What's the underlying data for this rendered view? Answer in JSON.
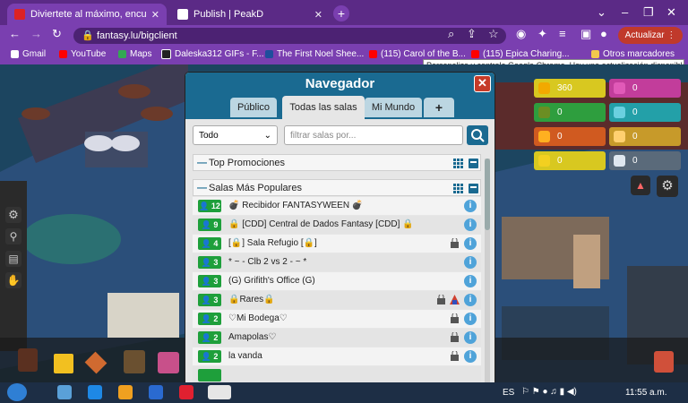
{
  "browser": {
    "tabs": [
      {
        "title": "Diviertete al máximo, encuent",
        "active": true
      },
      {
        "title": "Publish | PeakD",
        "active": false
      }
    ],
    "url": "fantasy.lu/bigclient",
    "update_label": "Actualizar",
    "bookmarks": [
      {
        "label": "Gmail",
        "color": "#ffffff"
      },
      {
        "label": "YouTube",
        "color": "#ff0000"
      },
      {
        "label": "Maps",
        "color": "#34a853"
      },
      {
        "label": "Daleska312 GIFs - F...",
        "color": "#222222"
      },
      {
        "label": "The First Noel Shee...",
        "color": "#1f4e9c"
      },
      {
        "label": "(115) Carol of the B...",
        "color": "#ff0000"
      },
      {
        "label": "(115) Epica Charing...",
        "color": "#ff0000"
      },
      {
        "label": "Otros marcadores",
        "color": "#f2c94c"
      }
    ],
    "tooltip": "Personaliza y controla Google Chrome. Hay una actualización disponible."
  },
  "navigator": {
    "title": "Navegador",
    "tabs": [
      {
        "label": "Público",
        "selected": false
      },
      {
        "label": "Todas las salas",
        "selected": true
      },
      {
        "label": "Mi Mundo",
        "selected": false
      },
      {
        "label": "+",
        "selected": false
      }
    ],
    "filter": {
      "selected": "Todo",
      "placeholder": "filtrar salas por..."
    },
    "sections": [
      {
        "title": "Top Promociones"
      },
      {
        "title": "Salas Más Populares"
      }
    ],
    "rooms": [
      {
        "users": "12",
        "name": "💣 Recibidor FANTASYWEEN 💣",
        "locked": false
      },
      {
        "users": "9",
        "name": "🔒 [CDD] Central de Dados Fantasy [CDD] 🔒",
        "locked": false
      },
      {
        "users": "4",
        "name": "[🔒] Sala Refugio [🔒]",
        "locked": true
      },
      {
        "users": "3",
        "name": "* ~ - Clb 2 vs 2 - ~ *",
        "locked": false
      },
      {
        "users": "3",
        "name": "(G) Grifith's Office (G)",
        "locked": false
      },
      {
        "users": "3",
        "name": "🔒Rares🔒",
        "locked": true
      },
      {
        "users": "2",
        "name": "♡Mi Bodega♡",
        "locked": true
      },
      {
        "users": "2",
        "name": "Amapolas♡",
        "locked": true
      },
      {
        "users": "2",
        "name": "la vanda",
        "locked": true
      }
    ]
  },
  "currency": [
    {
      "value": "360",
      "color": "#d8c820",
      "icon_color": "#f2a900"
    },
    {
      "value": "0",
      "color": "#c23d9b",
      "icon_color": "#e15ab8"
    },
    {
      "value": "0",
      "color": "#2e9e3e",
      "icon_color": "#6b8e23"
    },
    {
      "value": "0",
      "color": "#23a0a8",
      "icon_color": "#6ad0e0"
    },
    {
      "value": "0",
      "color": "#d05a20",
      "icon_color": "#ffb020"
    },
    {
      "value": "0",
      "color": "#c79a2a",
      "icon_color": "#ffd070"
    },
    {
      "value": "0",
      "color": "#d8c820",
      "icon_color": "#f2d020"
    },
    {
      "value": "0",
      "color": "#5a6a7a",
      "icon_color": "#dfe7ef"
    }
  ],
  "taskbar": {
    "language": "ES",
    "clock": "11:55 a.m."
  }
}
